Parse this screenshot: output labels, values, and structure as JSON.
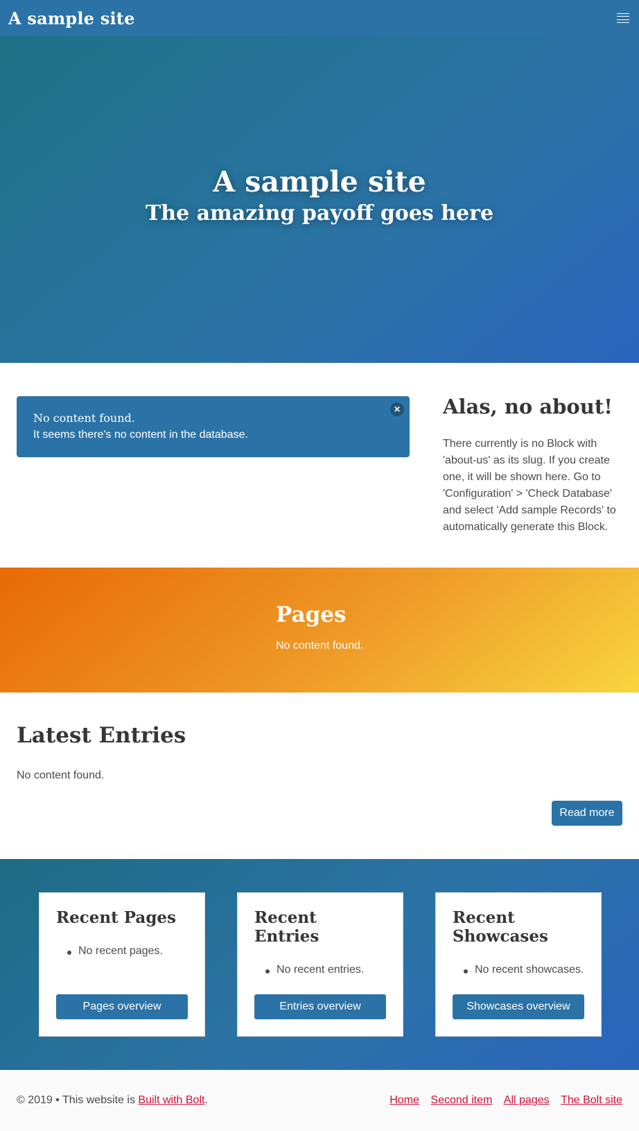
{
  "navbar": {
    "brand": "A sample site",
    "menu_icon": "hamburger-icon"
  },
  "hero": {
    "title": "A sample site",
    "subtitle": "The amazing payoff goes here"
  },
  "notice": {
    "title": "No content found.",
    "body": "It seems there's no content in the database.",
    "close_symbol": "✕"
  },
  "about": {
    "title": "Alas, no about!",
    "body": "There currently is no Block with 'about-us' as its slug. If you create one, it will be shown here. Go to 'Configuration' > 'Check Database' and select 'Add sample Records' to automatically generate this Block."
  },
  "pages_section": {
    "title": "Pages",
    "body": "No content found."
  },
  "latest": {
    "title": "Latest Entries",
    "body": "No content found.",
    "read_more": "Read more"
  },
  "recent": {
    "cards": [
      {
        "title": "Recent Pages",
        "item": "No recent pages.",
        "button": "Pages overview"
      },
      {
        "title": "Recent Entries",
        "item": "No recent entries.",
        "button": "Entries overview"
      },
      {
        "title": "Recent Showcases",
        "item": "No recent showcases.",
        "button": "Showcases overview"
      }
    ]
  },
  "footer": {
    "prefix": "© 2019 • This website is ",
    "built_with": "Built with Bolt",
    "suffix": ".",
    "links": [
      "Home",
      "Second item",
      "All pages",
      "The Bolt site"
    ]
  },
  "colors": {
    "primary": "#2b73a6",
    "link": "#d0123a",
    "warm_start": "#e76a05",
    "warm_end": "#f8d540"
  }
}
